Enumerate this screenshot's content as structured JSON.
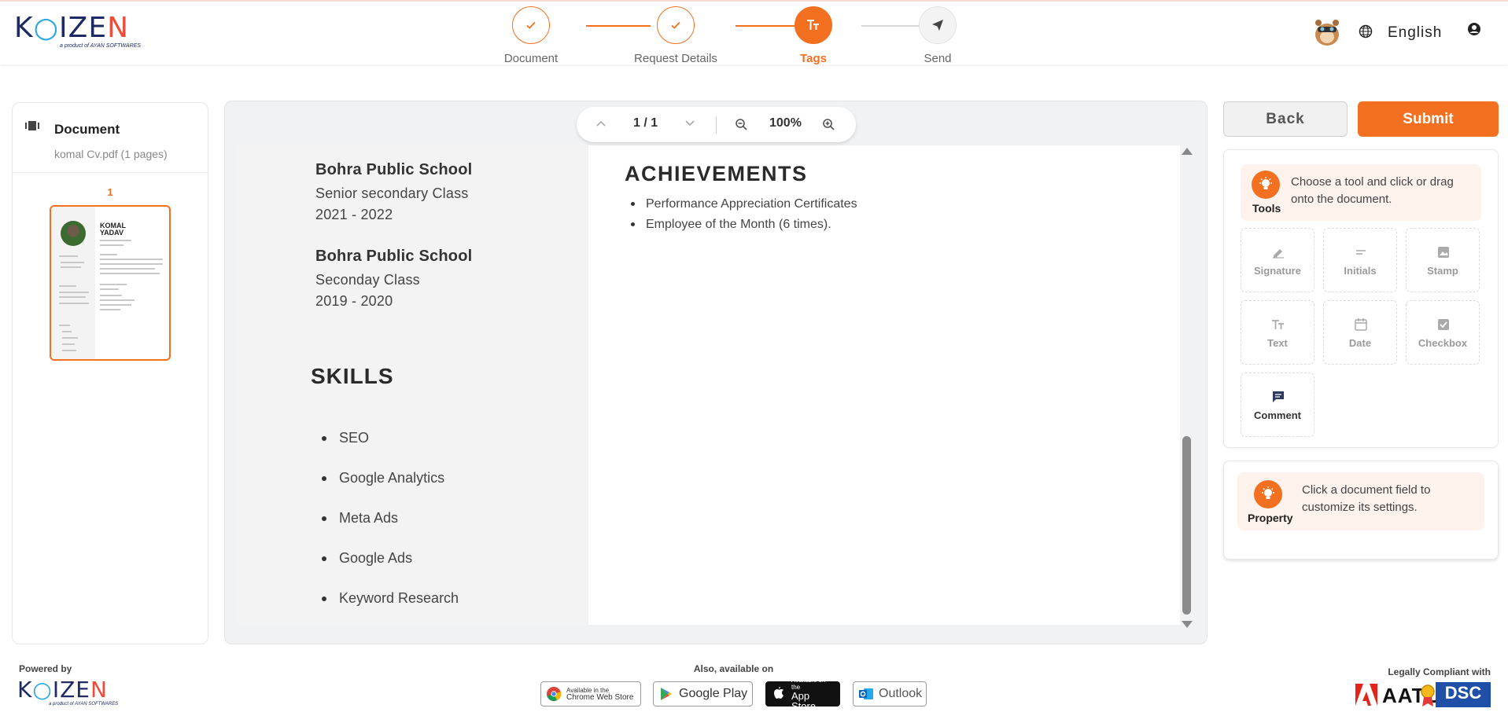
{
  "brand": {
    "name": "KAIZEN",
    "tagline": "a product of AYAN SOFTWARES",
    "accent": "#f37021"
  },
  "stepper": {
    "steps": [
      {
        "label": "Document",
        "state": "done",
        "icon": "check-icon"
      },
      {
        "label": "Request Details",
        "state": "done",
        "icon": "check-icon"
      },
      {
        "label": "Tags",
        "state": "active",
        "icon": "text-size-icon"
      },
      {
        "label": "Send",
        "state": "pending",
        "icon": "send-icon"
      }
    ]
  },
  "header": {
    "language": "English"
  },
  "left_panel": {
    "title": "Document",
    "subtitle": "komal Cv.pdf (1 pages)",
    "page_number": "1",
    "thumb_name": "KOMAL YADAV"
  },
  "viewer": {
    "page_indicator": "1 / 1",
    "zoom": "100%",
    "education": [
      {
        "school": "Bohra Public School",
        "class": "Senior secondary Class",
        "years": "2021 - 2022"
      },
      {
        "school": "Bohra Public School",
        "class": "Seconday Class",
        "years": "2019 - 2020"
      }
    ],
    "skills_heading": "SKILLS",
    "skills": [
      "SEO",
      "Google Analytics",
      "Meta Ads",
      "Google Ads",
      "Keyword Research"
    ],
    "achievements_heading": "ACHIEVEMENTS",
    "achievements": [
      "Performance Appreciation Certificates",
      "Employee of the Month (6 times)."
    ]
  },
  "actions": {
    "back": "Back",
    "submit": "Submit"
  },
  "tools": {
    "hint_title": "Tools",
    "hint_text": "Choose a tool and click or drag onto the document.",
    "items": [
      {
        "label": "Signature",
        "icon": "signature-icon",
        "enabled": false
      },
      {
        "label": "Initials",
        "icon": "initials-icon",
        "enabled": false
      },
      {
        "label": "Stamp",
        "icon": "stamp-icon",
        "enabled": false
      },
      {
        "label": "Text",
        "icon": "text-icon",
        "enabled": false
      },
      {
        "label": "Date",
        "icon": "calendar-icon",
        "enabled": false
      },
      {
        "label": "Checkbox",
        "icon": "checkbox-icon",
        "enabled": false
      },
      {
        "label": "Comment",
        "icon": "comment-icon",
        "enabled": true
      }
    ]
  },
  "property": {
    "title": "Property",
    "text": "Click a document field to customize its settings."
  },
  "footer": {
    "powered_by": "Powered by",
    "also_available": "Also, available on",
    "stores": [
      {
        "small": "Available in the",
        "name": "Chrome Web Store"
      },
      {
        "name": "Google Play"
      },
      {
        "small": "Available on the",
        "name": "App Store"
      },
      {
        "name": "Outlook"
      }
    ],
    "compliant": "Legally Compliant with",
    "aatl": "AATL",
    "dsc": "DSC"
  }
}
